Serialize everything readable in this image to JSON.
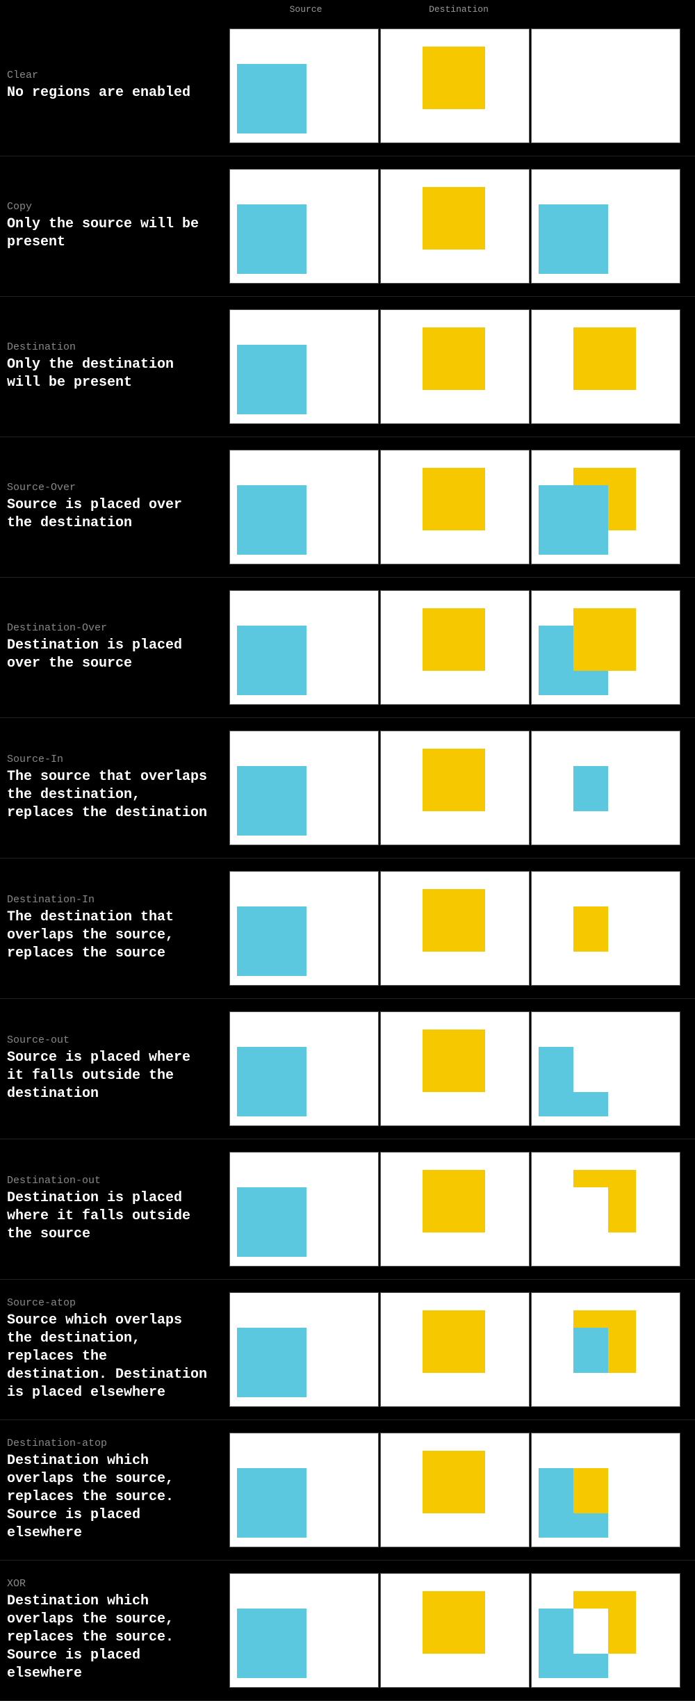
{
  "header": {
    "col1": "Source",
    "col2": "Destination",
    "col3": ""
  },
  "rows": [
    {
      "id": "clear",
      "title": "Clear",
      "desc": "No regions are enabled",
      "source_has_blue": true,
      "dest_has_yellow": true,
      "result": "clear"
    },
    {
      "id": "copy",
      "title": "Copy",
      "desc": "Only the source will be present",
      "source_has_blue": true,
      "dest_has_yellow": true,
      "result": "copy"
    },
    {
      "id": "destination",
      "title": "Destination",
      "desc": "Only the destination will be present",
      "source_has_blue": true,
      "dest_has_yellow": true,
      "result": "destination"
    },
    {
      "id": "source-over",
      "title": "Source-Over",
      "desc": "Source is placed over the destination",
      "source_has_blue": true,
      "dest_has_yellow": true,
      "result": "source-over"
    },
    {
      "id": "destination-over",
      "title": "Destination-Over",
      "desc": "Destination is placed over the source",
      "source_has_blue": true,
      "dest_has_yellow": true,
      "result": "destination-over"
    },
    {
      "id": "source-in",
      "title": "Source-In",
      "desc": "The source that overlaps the destination, replaces the destination",
      "source_has_blue": true,
      "dest_has_yellow": true,
      "result": "source-in"
    },
    {
      "id": "destination-in",
      "title": "Destination-In",
      "desc": "The destination that overlaps the source, replaces the source",
      "source_has_blue": true,
      "dest_has_yellow": true,
      "result": "destination-in"
    },
    {
      "id": "source-out",
      "title": "Source-out",
      "desc": "Source is placed where it falls outside the destination",
      "source_has_blue": true,
      "dest_has_yellow": true,
      "result": "source-out"
    },
    {
      "id": "destination-out",
      "title": "Destination-out",
      "desc": "Destination is placed where it falls outside the source",
      "source_has_blue": true,
      "dest_has_yellow": true,
      "result": "destination-out"
    },
    {
      "id": "source-atop",
      "title": "Source-atop",
      "desc": "Source which overlaps the destination, replaces the destination. Destination is placed elsewhere",
      "source_has_blue": true,
      "dest_has_yellow": true,
      "result": "source-atop"
    },
    {
      "id": "destination-atop",
      "title": "Destination-atop",
      "desc": "Destination which overlaps the source, replaces the source. Source is placed elsewhere",
      "source_has_blue": true,
      "dest_has_yellow": true,
      "result": "destination-atop"
    },
    {
      "id": "xor",
      "title": "XOR",
      "desc": "Destination which overlaps the source, replaces the source. Source is placed elsewhere",
      "source_has_blue": true,
      "dest_has_yellow": true,
      "result": "xor"
    }
  ]
}
